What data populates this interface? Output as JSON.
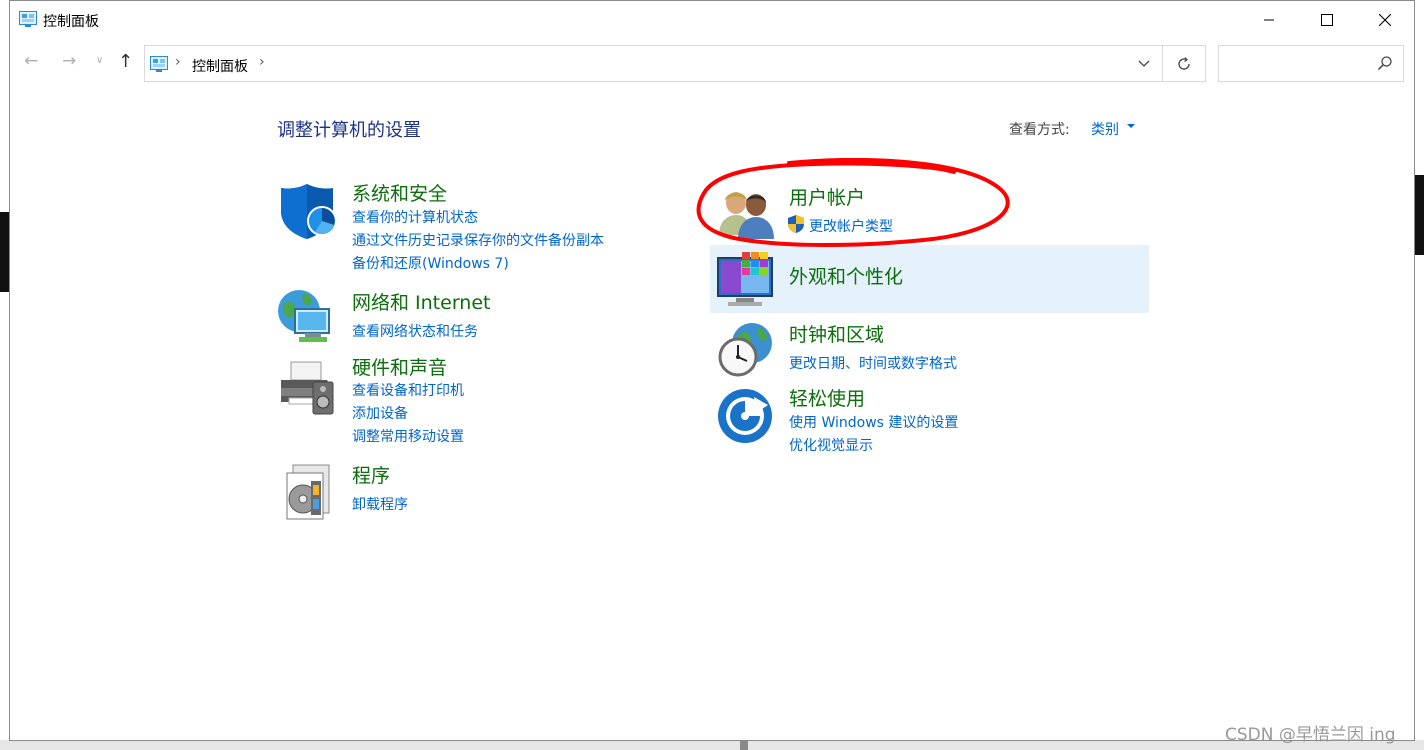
{
  "window": {
    "title": "控制面板",
    "address_crumb": "控制面板",
    "search_placeholder": ""
  },
  "content": {
    "page_title": "调整计算机的设置",
    "view_by_label": "查看方式:",
    "view_by_value": "类别"
  },
  "categories": [
    {
      "title": "系统和安全",
      "icon": "shield-icon",
      "links": [
        "查看你的计算机状态",
        "通过文件历史记录保存你的文件备份副本",
        "备份和还原(Windows 7)"
      ]
    },
    {
      "title": "网络和 Internet",
      "icon": "network-globe-icon",
      "links": [
        "查看网络状态和任务"
      ]
    },
    {
      "title": "硬件和声音",
      "icon": "printer-speaker-icon",
      "links": [
        "查看设备和打印机",
        "添加设备",
        "调整常用移动设置"
      ]
    },
    {
      "title": "程序",
      "icon": "programs-disc-icon",
      "links": [
        "卸载程序"
      ]
    },
    {
      "title": "用户帐户",
      "icon": "user-accounts-icon",
      "links": [
        "更改帐户类型"
      ]
    },
    {
      "title": "外观和个性化",
      "icon": "monitor-palette-icon",
      "links": []
    },
    {
      "title": "时钟和区域",
      "icon": "clock-globe-icon",
      "links": [
        "更改日期、时间或数字格式"
      ]
    },
    {
      "title": "轻松使用",
      "icon": "ease-of-access-icon",
      "links": [
        "使用 Windows 建议的设置",
        "优化视觉显示"
      ]
    }
  ],
  "colors": {
    "title_blue": "#1e3287",
    "category_green": "#0b6e0b",
    "link_blue": "#0066cc",
    "highlight": "#e5f1fb",
    "annotation_red": "#ff0000"
  },
  "watermark": "CSDN @早悟兰因 ing"
}
